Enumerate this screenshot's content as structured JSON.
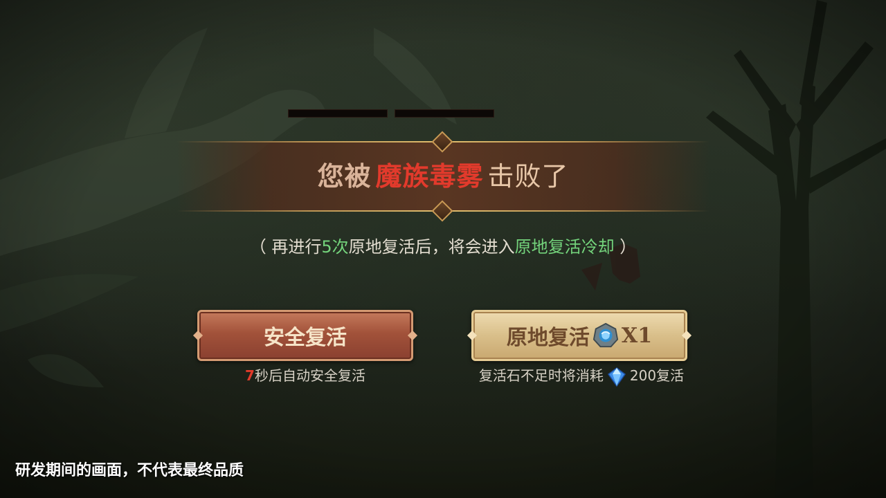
{
  "hud": {
    "hp_bars": 2
  },
  "defeat_banner": {
    "prefix": "您被",
    "enemy_name": "魔族毒雾",
    "suffix": "击败了"
  },
  "revive_note": {
    "open": "（ 再进行",
    "count": "5次",
    "mid": "原地复活后，将会进入",
    "cooldown": "原地复活冷却",
    "close": " ）"
  },
  "buttons": {
    "safe_revive": {
      "label": "安全复活",
      "countdown_seconds": "7",
      "countdown_text": "秒后自动安全复活"
    },
    "in_place_revive": {
      "label": "原地复活",
      "item_icon": "revive-stone-icon",
      "item_count": "X1",
      "cost_text": "复活石不足时将消耗",
      "currency_icon": "diamond-icon",
      "cost_amount": "200",
      "cost_suffix": "复活"
    }
  },
  "disclaimer": "研发期间的画面，不代表最终品质",
  "colors": {
    "enemy_red": "#e23a2c",
    "highlight_green": "#74d47c",
    "countdown_red": "#e03a2a",
    "safe_button": "#a2523a",
    "in_place_button": "#d9bf8a"
  }
}
